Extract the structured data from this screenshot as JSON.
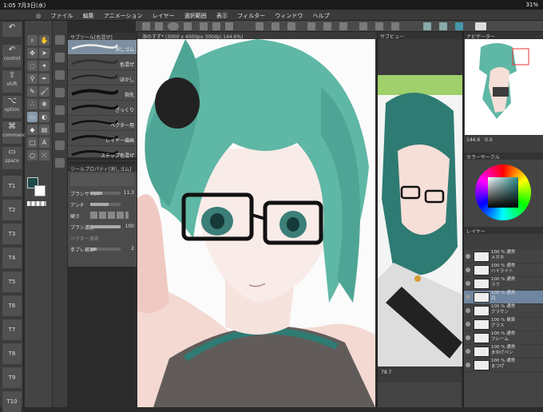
{
  "status": {
    "time": "1:05",
    "date": "7月3日(水)",
    "battery": "31%"
  },
  "menu": [
    "ファイル",
    "編集",
    "アニメーション",
    "レイヤー",
    "選択範囲",
    "表示",
    "フィルター",
    "ウィンドウ",
    "ヘルプ"
  ],
  "modifiers": [
    {
      "label": "control",
      "icon": "↶"
    },
    {
      "label": "shift",
      "icon": "⇧"
    },
    {
      "label": "option",
      "icon": "⌥"
    },
    {
      "label": "command",
      "icon": "⌘"
    },
    {
      "label": "space",
      "icon": "▭"
    }
  ],
  "tkeys": [
    "T1",
    "T2",
    "T3",
    "T4",
    "T5",
    "T6",
    "T7",
    "T8",
    "T9",
    "T10"
  ],
  "subtool": {
    "header": "サブツール[色混ぜ]",
    "brushes": [
      "色混ぜ",
      "指先",
      "ぼかし",
      "ざっくり",
      "ベクター用",
      "レイヤー描画",
      "ステップ色混ぜ",
      "消しゴム"
    ]
  },
  "toolprop": {
    "header": "ツールプロパティ[消しゴム]",
    "rows": [
      {
        "label": "ブラシサイズ",
        "value": "11.3"
      },
      {
        "label": "アンチ",
        "value": ""
      },
      {
        "label": "硬さ",
        "value": ""
      },
      {
        "label": "ブラシ濃度",
        "value": "100"
      },
      {
        "label": "ベクター消去",
        "value": ""
      },
      {
        "label": "手ブレ補正",
        "value": "2"
      }
    ]
  },
  "canvas": {
    "tab": "海のすず* (3000 x 4000px 300dpi 144.6%)"
  },
  "subview": {
    "header": "サブビュー",
    "zoom": "78.7"
  },
  "navigator": {
    "header": "ナビゲーター",
    "zoom": "144.6",
    "angle": "0.0"
  },
  "colorcircle": {
    "header": "カラーサークル"
  },
  "layers": {
    "header": "レイヤー",
    "items": [
      {
        "pct": "100 % 通常",
        "name": "メガネ"
      },
      {
        "pct": "100 % 通常",
        "name": "ハイライト"
      },
      {
        "pct": "100 % 通常",
        "name": "ラフ"
      },
      {
        "pct": "100 % 通常",
        "name": "目"
      },
      {
        "pct": "100 % 通常",
        "name": "グラサン"
      },
      {
        "pct": "100 % 乗算",
        "name": "グラス"
      },
      {
        "pct": "100 % 通常",
        "name": "フレーム"
      },
      {
        "pct": "100 % 通常",
        "name": "まゆげペン"
      },
      {
        "pct": "100 % 通常",
        "name": "まつげ"
      }
    ]
  },
  "colors": {
    "accent": "#6f86a0",
    "hair": "#5fb7a5",
    "dark_teal": "#1e4a4a",
    "mid_teal": "#2e7b73"
  }
}
